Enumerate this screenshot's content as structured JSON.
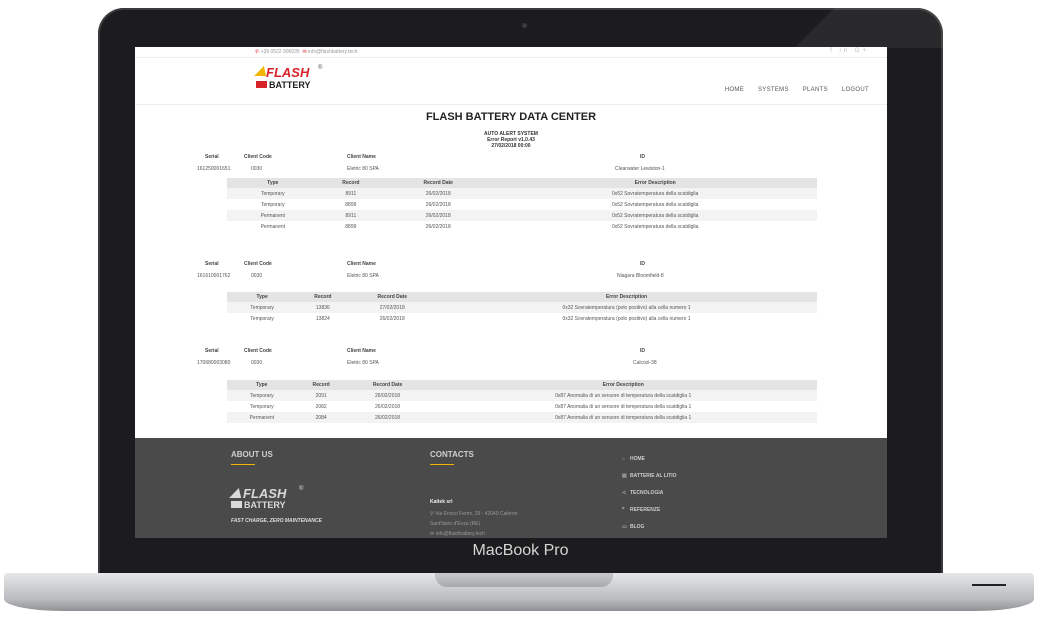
{
  "device": {
    "label": "MacBook Pro"
  },
  "topbar": {
    "phone": "+39 0522 906035",
    "email": "info@flashbattery.tech",
    "social": "f  in  G+"
  },
  "logo": {
    "line1": "FLASH",
    "line2": "BATTERY",
    "reg": "®"
  },
  "nav": {
    "items": [
      "HOME",
      "SYSTEMS",
      "PLANTS",
      "LOGOUT"
    ]
  },
  "page": {
    "title": "FLASH BATTERY DATA CENTER",
    "system": "AUTO ALERT SYSTEM",
    "report": "Error Report v1.0.43",
    "date": "27/02/2018 00:00"
  },
  "columns": {
    "serial": "Serial",
    "client_code": "Client Code",
    "client_name": "Client Name",
    "id": "ID"
  },
  "table_headers": [
    "Type",
    "Record",
    "Record Date",
    "Error Description"
  ],
  "blocks": [
    {
      "serial": "161250001651",
      "client_code": "0030",
      "client_name": "Eletric 80 SPA",
      "id": "Clearwater Lewiston-1",
      "rows": [
        [
          "Temporary",
          "8911",
          "26/02/2018",
          "0x52 Sovratemperatura della scatdiglia"
        ],
        [
          "Temporary",
          "8899",
          "26/02/2018",
          "0x52 Sovratemperatura della scatdiglia"
        ],
        [
          "Permanent",
          "8911",
          "26/02/2018",
          "0x52 Sovratemperatura della scatdiglia"
        ],
        [
          "Permanent",
          "8899",
          "26/02/2018",
          "0x52 Sovratemperatura della scatdiglia"
        ]
      ]
    },
    {
      "serial": "161610001762",
      "client_code": "0030",
      "client_name": "Eletric 80 SPA",
      "id": "Niagara Bloomfield-8",
      "rows": [
        [
          "Temporary",
          "13836",
          "27/02/2018",
          "0x32 Sovratemperatura (polo positivo) alla cella numero 1"
        ],
        [
          "Temporary",
          "13824",
          "26/02/2018",
          "0x32 Sovratemperatura (polo positivo) alla cella numero 1"
        ]
      ]
    },
    {
      "serial": "170680003080",
      "client_code": "0030",
      "client_name": "Eletric 80 SPA",
      "id": "Calcozi-38",
      "rows": [
        [
          "Temporary",
          "2091",
          "26/02/2018",
          "0x87 Anomalia di un sensore di temperatura della scatdiglia 1"
        ],
        [
          "Temporary",
          "2082",
          "26/02/2018",
          "0x87 Anomalia di un sensore di temperatura della scatdiglia 1"
        ],
        [
          "Permanent",
          "2084",
          "26/02/2018",
          "0x87 Anomalia di un sensore di temperatura della scatdiglia 1"
        ]
      ]
    }
  ],
  "footer": {
    "about_title": "ABOUT US",
    "tagline": "FAST CHARGE, ZERO MAINTENANCE",
    "contacts_title": "CONTACTS",
    "company": "Kaitek srl",
    "address": "Via Enrico Fermi, 29 - 42049 Calerno",
    "city": "Sant'Ilario d'Enza (RE)",
    "email": "info@flashbattery.tech",
    "links": [
      "HOME",
      "BATTERIE AL LITIO",
      "TECNOLOGIA",
      "REFERENZE",
      "BLOG"
    ]
  }
}
